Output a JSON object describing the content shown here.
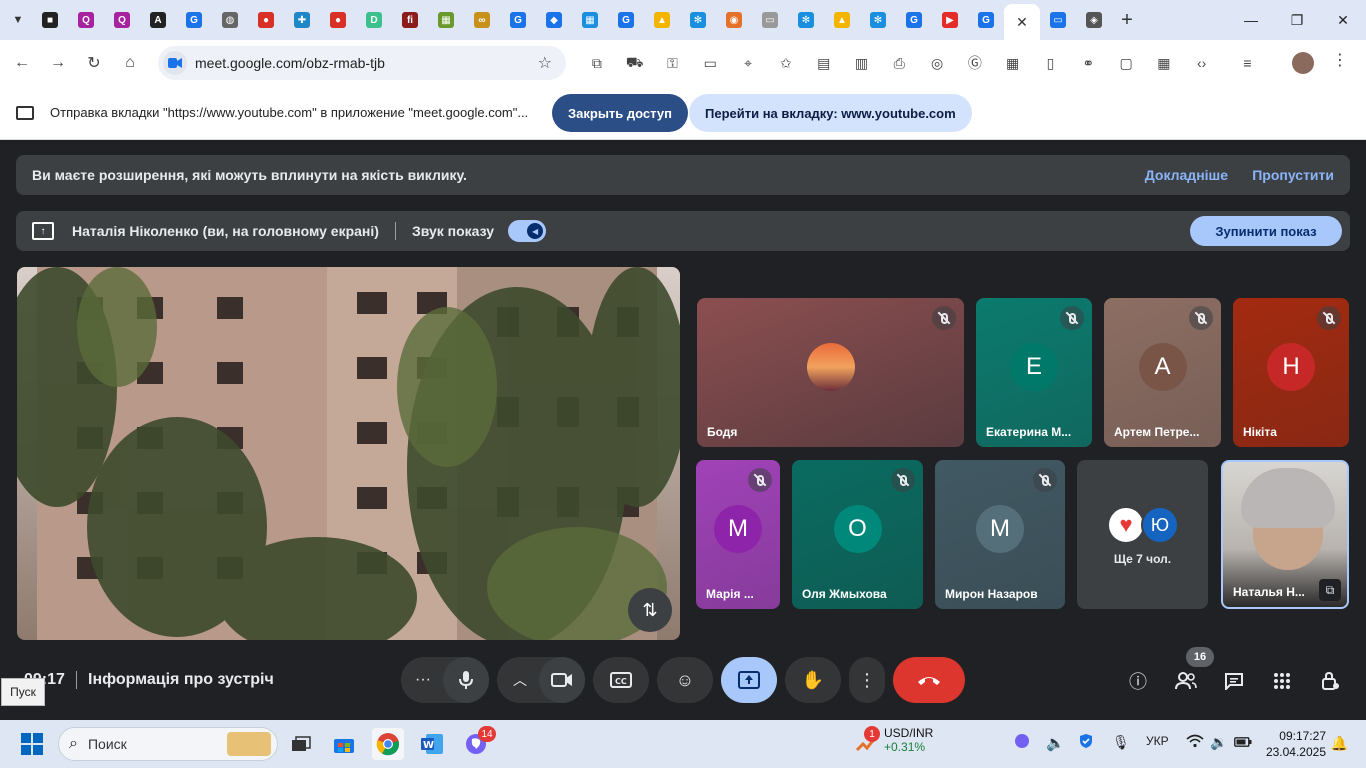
{
  "browser": {
    "active_tab_close": "✕",
    "new_tab": "+",
    "url": "meet.google.com/obz-rmab-tjb",
    "tab_favicons": [
      {
        "char": "■",
        "color": "#222"
      },
      {
        "char": "Q",
        "color": "#a7229e"
      },
      {
        "char": "Q",
        "color": "#a7229e"
      },
      {
        "char": "A",
        "color": "#222"
      },
      {
        "char": "G",
        "color": "#1a73e8"
      },
      {
        "char": "◍",
        "color": "#666"
      },
      {
        "char": "●",
        "color": "#d93025"
      },
      {
        "char": "✚",
        "color": "#1e88c7"
      },
      {
        "char": "●",
        "color": "#d93025"
      },
      {
        "char": "D",
        "color": "#3cc18c"
      },
      {
        "char": "fi",
        "color": "#8a1c1c"
      },
      {
        "char": "▦",
        "color": "#6a9a2e"
      },
      {
        "char": "∞",
        "color": "#c8911a"
      },
      {
        "char": "G",
        "color": "#1a73e8"
      },
      {
        "char": "◆",
        "color": "#1a73e8"
      },
      {
        "char": "▦",
        "color": "#1a8fe0"
      },
      {
        "char": "G",
        "color": "#1a73e8"
      },
      {
        "char": "▲",
        "color": "#f4b400"
      },
      {
        "char": "✻",
        "color": "#1a8fe0"
      },
      {
        "char": "◉",
        "color": "#e6722a"
      },
      {
        "char": "▭",
        "color": "#999"
      },
      {
        "char": "✻",
        "color": "#1a8fe0"
      },
      {
        "char": "▲",
        "color": "#f4b400"
      },
      {
        "char": "✻",
        "color": "#1a8fe0"
      },
      {
        "char": "G",
        "color": "#1a73e8"
      },
      {
        "char": "▶",
        "color": "#e52d27"
      },
      {
        "char": "G",
        "color": "#1a73e8"
      }
    ]
  },
  "share_notice": {
    "message": "Отправка вкладки \"https://www.youtube.com\" в приложение \"meet.google.com\"...",
    "stop_access": "Закрыть доступ",
    "go_to_tab": "Перейти на вкладку: www.youtube.com"
  },
  "warning": {
    "text": "Ви маєте розширення, які можуть вплинути на якість виклику.",
    "learn_more": "Докладніше",
    "skip": "Пропустити"
  },
  "presenting": {
    "name": "Наталія Ніколенко (ви, на головному екрані)",
    "sound_label": "Звук показу",
    "stop_button": "Зупинити показ"
  },
  "participants": [
    {
      "name": "Бодя",
      "initial": "",
      "bg": "#7a4f4a",
      "avatar_bg": "#d06a3a"
    },
    {
      "name": "Екатерина М...",
      "initial": "Е",
      "bg": "#0c7a6e",
      "avatar_bg": "#00796b"
    },
    {
      "name": "Артем Петре...",
      "initial": "А",
      "bg": "#8d6e63",
      "avatar_bg": "#795548"
    },
    {
      "name": "Нікіта",
      "initial": "Н",
      "bg": "#a32a10",
      "avatar_bg": "#c62828"
    },
    {
      "name": "Марія ...",
      "initial": "М",
      "bg": "#a042b8",
      "avatar_bg": "#8e24aa"
    },
    {
      "name": "Оля Жмыхова",
      "initial": "О",
      "bg": "#0a6b60",
      "avatar_bg": "#00897b"
    },
    {
      "name": "Мирон Назаров",
      "initial": "М",
      "bg": "#415963",
      "avatar_bg": "#546e7a"
    },
    {
      "name": "Наталья Н...",
      "initial": "",
      "bg": "#c9c6c2",
      "avatar_bg": "#c9c6c2"
    }
  ],
  "more_tile": {
    "label": "Ще 7 чол.",
    "initial": "Ю"
  },
  "bottom": {
    "time": "09:17",
    "meeting_info": "Інформація про зустріч",
    "tooltip": "Пуск",
    "people_count": "16"
  },
  "taskbar": {
    "search_placeholder": "Поиск",
    "viber_badge": "14",
    "ticker_badge": "1",
    "ticker_name": "USD/INR",
    "ticker_change": "+0.31%",
    "language": "УКР",
    "time": "09:17:27",
    "date": "23.04.2025"
  }
}
